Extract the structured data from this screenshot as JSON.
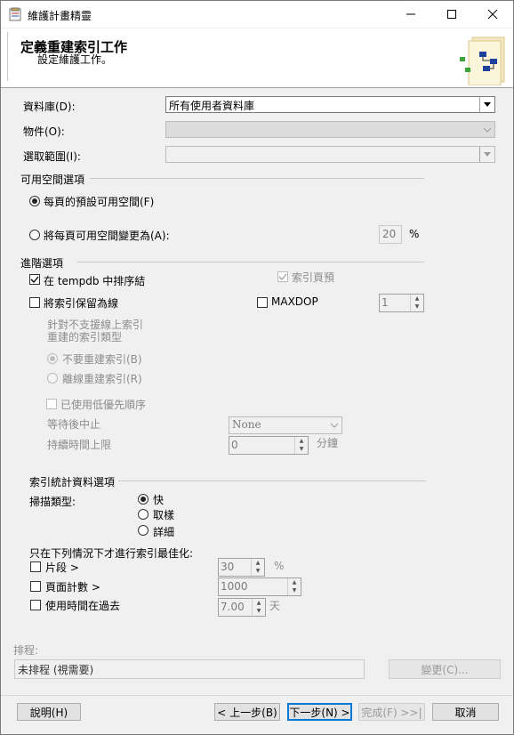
{
  "window": {
    "title": "維護計畫精靈"
  },
  "header": {
    "title": "定義重建索引工作",
    "subtitle": "設定維護工作。"
  },
  "database": {
    "label": "資料庫(D):",
    "value": "所有使用者資料庫"
  },
  "object": {
    "label": "物件(O):",
    "value": ""
  },
  "scope": {
    "label": "選取範圍(I):",
    "value": ""
  },
  "free_space": {
    "group": "可用空間選項",
    "default_option": "每頁的預設可用空間(F)",
    "change_option": "將每頁可用空間變更為(A):",
    "percent_value": "20",
    "percent_unit": "%"
  },
  "advanced": {
    "group": "進階選項",
    "sort_tempdb": "在 tempdb 中排序結",
    "pad_index": "索引頁預",
    "keep_online": "將索引保留為線",
    "maxdop_label": "MAXDOP",
    "maxdop_value": "1",
    "offline_note": "針對不支援線上索引\n重建的索引類型",
    "no_rebuild": "不要重建索引(B)",
    "offline_rebuild": "離線重建索引(R)",
    "low_priority": "已使用低優先順序",
    "abort_after_wait_label": "等待後中止",
    "abort_after_wait_value": "None",
    "max_duration_label": "持續時間上限",
    "max_duration_value": "0",
    "max_duration_unit": "分鐘"
  },
  "stats": {
    "group": "索引統計資料選項",
    "scan_type_label": "掃描類型:",
    "fast": "快",
    "sampled": "取樣",
    "detailed": "詳細"
  },
  "optimize": {
    "title": "只在下列情況下才進行索引最佳化:",
    "fragment_label": "片段 >",
    "fragment_value": "30",
    "fragment_unit": "%",
    "page_count_label": "頁面計數 >",
    "page_count_value": "1000",
    "used_label": "使用時間在過去",
    "used_value": "7.00",
    "used_unit": "天"
  },
  "schedule": {
    "label": "排程:",
    "value": "未排程 (視需要)",
    "change_button": "變更(C)..."
  },
  "footer": {
    "help": "說明(H)",
    "back": "< 上一步(B)",
    "next": "下一步(N) >",
    "finish": "完成(F) >>|",
    "cancel": "取消"
  }
}
